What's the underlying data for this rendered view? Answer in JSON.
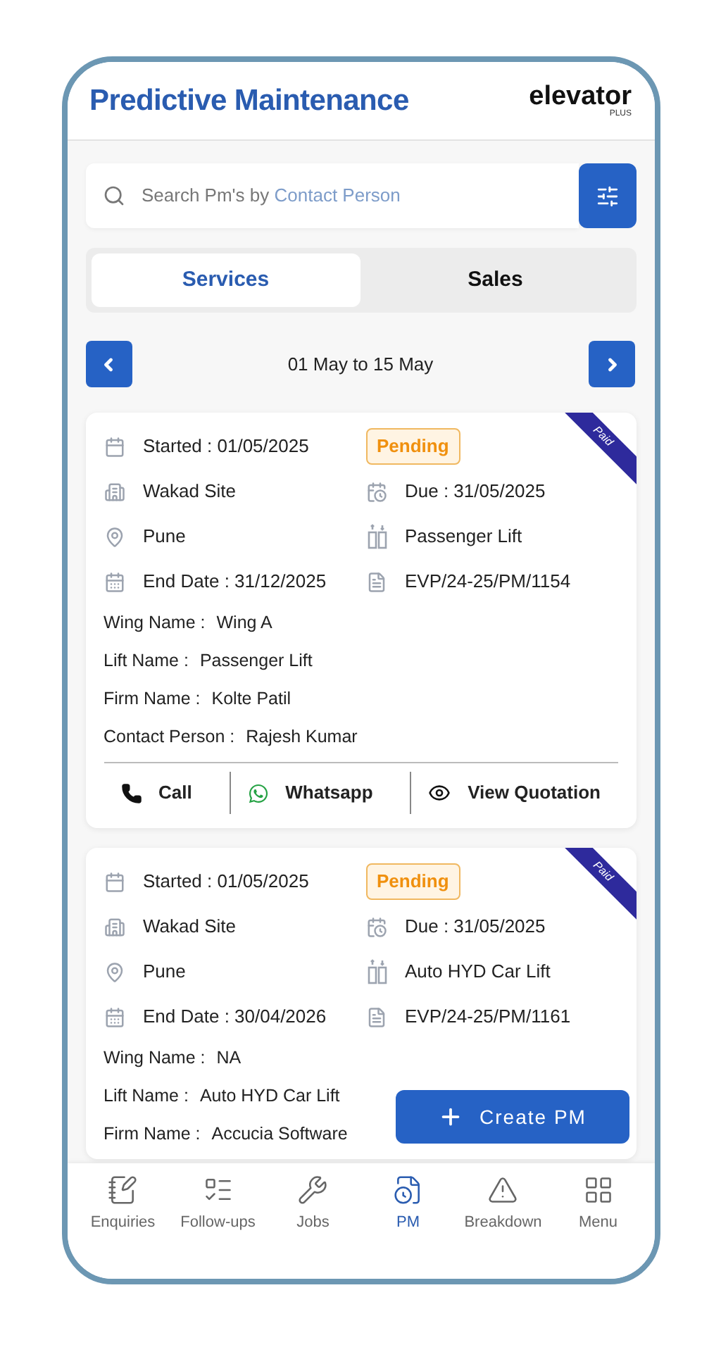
{
  "header": {
    "title": "Predictive Maintenance",
    "logo_text": "elevator",
    "logo_sub": "PLUS"
  },
  "search": {
    "placeholder_prefix": "Search Pm's by",
    "placeholder_field": "Contact Person"
  },
  "tabs": [
    {
      "label": "Services",
      "selected": true
    },
    {
      "label": "Sales",
      "selected": false
    }
  ],
  "date_range": "01 May to 15 May",
  "cards": [
    {
      "started": "Started : 01/05/2025",
      "status": "Pending",
      "ribbon": "Paid",
      "site": "Wakad Site",
      "due": "Due : 31/05/2025",
      "city": "Pune",
      "lift_type": "Passenger Lift",
      "end_date": "End Date : 31/12/2025",
      "ref": "EVP/24-25/PM/1154",
      "details": [
        {
          "label": "Wing Name :",
          "value": "Wing A"
        },
        {
          "label": "Lift Name :",
          "value": "Passenger Lift"
        },
        {
          "label": "Firm Name  :",
          "value": "Kolte Patil"
        },
        {
          "label": "Contact Person :",
          "value": "Rajesh Kumar"
        }
      ],
      "actions": [
        {
          "kind": "call",
          "label": "Call"
        },
        {
          "kind": "whatsapp",
          "label": "Whatsapp"
        },
        {
          "kind": "view",
          "label": "View Quotation"
        }
      ]
    },
    {
      "started": "Started : 01/05/2025",
      "status": "Pending",
      "ribbon": "Paid",
      "site": "Wakad Site",
      "due": "Due : 31/05/2025",
      "city": "Pune",
      "lift_type": "Auto HYD Car Lift",
      "end_date": "End Date : 30/04/2026",
      "ref": "EVP/24-25/PM/1161",
      "details": [
        {
          "label": "Wing Name :",
          "value": "NA"
        },
        {
          "label": "Lift Name :",
          "value": "Auto HYD Car Lift"
        },
        {
          "label": "Firm Name  :",
          "value": "Accucia Software"
        }
      ]
    }
  ],
  "create_button": "Create PM",
  "nav": [
    {
      "kind": "enquiries",
      "label": "Enquiries",
      "selected": false
    },
    {
      "kind": "followups",
      "label": "Follow-ups",
      "selected": false
    },
    {
      "kind": "jobs",
      "label": "Jobs",
      "selected": false
    },
    {
      "kind": "pm",
      "label": "PM",
      "selected": true
    },
    {
      "kind": "breakdown",
      "label": "Breakdown",
      "selected": false
    },
    {
      "kind": "menu",
      "label": "Menu",
      "selected": false
    }
  ]
}
